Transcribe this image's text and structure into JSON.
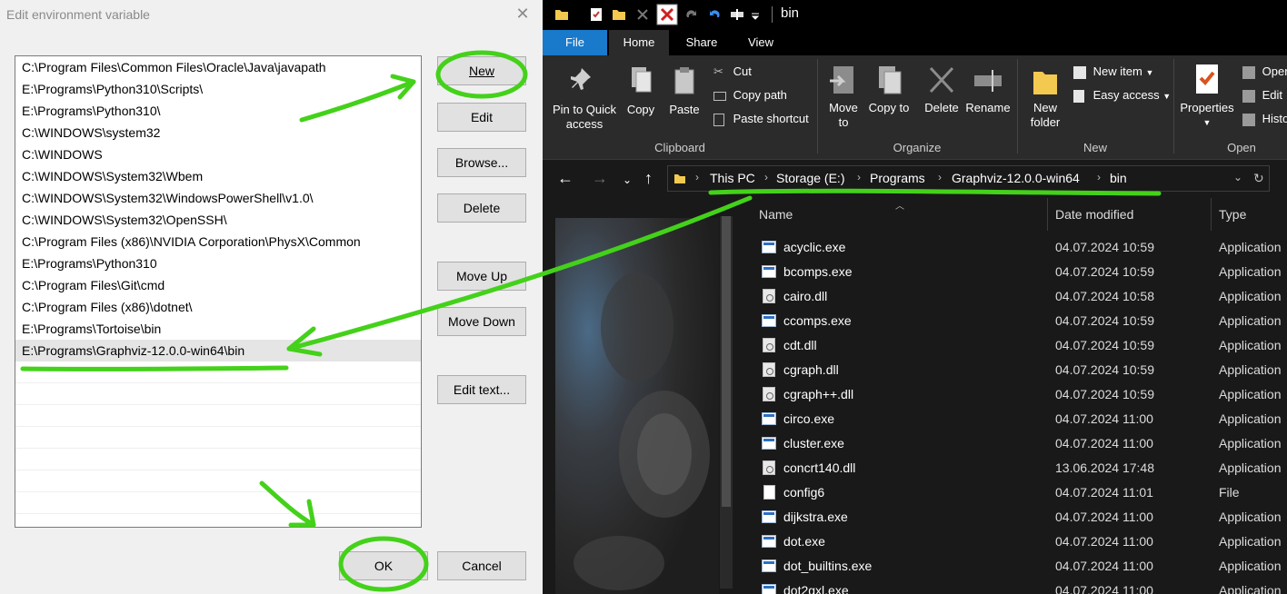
{
  "dialog": {
    "title": "Edit environment variable",
    "paths": [
      "C:\\Program Files\\Common Files\\Oracle\\Java\\javapath",
      "E:\\Programs\\Python310\\Scripts\\",
      "E:\\Programs\\Python310\\",
      "C:\\WINDOWS\\system32",
      "C:\\WINDOWS",
      "C:\\WINDOWS\\System32\\Wbem",
      "C:\\WINDOWS\\System32\\WindowsPowerShell\\v1.0\\",
      "C:\\WINDOWS\\System32\\OpenSSH\\",
      "C:\\Program Files (x86)\\NVIDIA Corporation\\PhysX\\Common",
      "E:\\Programs\\Python310",
      "C:\\Program Files\\Git\\cmd",
      "C:\\Program Files (x86)\\dotnet\\",
      "E:\\Programs\\Tortoise\\bin",
      "E:\\Programs\\Graphviz-12.0.0-win64\\bin"
    ],
    "selected_path": "E:\\Programs\\Graphviz-12.0.0-win64\\bin",
    "buttons": {
      "new": "New",
      "edit": "Edit",
      "browse": "Browse...",
      "delete": "Delete",
      "move_up": "Move Up",
      "move_down": "Move Down",
      "edit_text": "Edit text...",
      "ok": "OK",
      "cancel": "Cancel"
    }
  },
  "explorer": {
    "window_title": "bin",
    "tabs": [
      "File",
      "Home",
      "Share",
      "View"
    ],
    "ribbon": {
      "pin_to_quick_access": "Pin to Quick access",
      "copy": "Copy",
      "paste": "Paste",
      "cut": "Cut",
      "copy_path": "Copy path",
      "paste_shortcut": "Paste shortcut",
      "move_to": "Move to",
      "copy_to": "Copy to",
      "delete": "Delete",
      "rename": "Rename",
      "new_folder": "New folder",
      "new_item": "New item",
      "easy_access": "Easy access",
      "properties": "Properties",
      "open": "Open",
      "edit": "Edit",
      "history": "History",
      "groups": [
        "Clipboard",
        "Organize",
        "New",
        "Open"
      ]
    },
    "breadcrumb": [
      "This PC",
      "Storage (E:)",
      "Programs",
      "Graphviz-12.0.0-win64",
      "bin"
    ],
    "columns": {
      "name": "Name",
      "date": "Date modified",
      "type": "Type"
    },
    "files": [
      {
        "name": "acyclic.exe",
        "date": "04.07.2024 10:59",
        "type": "Application",
        "icon": "exe-icon"
      },
      {
        "name": "bcomps.exe",
        "date": "04.07.2024 10:59",
        "type": "Application",
        "icon": "exe-icon"
      },
      {
        "name": "cairo.dll",
        "date": "04.07.2024 10:58",
        "type": "Application",
        "icon": "dll-icon"
      },
      {
        "name": "ccomps.exe",
        "date": "04.07.2024 10:59",
        "type": "Application",
        "icon": "exe-icon"
      },
      {
        "name": "cdt.dll",
        "date": "04.07.2024 10:59",
        "type": "Application",
        "icon": "dll-icon"
      },
      {
        "name": "cgraph.dll",
        "date": "04.07.2024 10:59",
        "type": "Application",
        "icon": "dll-icon"
      },
      {
        "name": "cgraph++.dll",
        "date": "04.07.2024 10:59",
        "type": "Application",
        "icon": "dll-icon"
      },
      {
        "name": "circo.exe",
        "date": "04.07.2024 11:00",
        "type": "Application",
        "icon": "exe-icon"
      },
      {
        "name": "cluster.exe",
        "date": "04.07.2024 11:00",
        "type": "Application",
        "icon": "exe-icon"
      },
      {
        "name": "concrt140.dll",
        "date": "13.06.2024 17:48",
        "type": "Application",
        "icon": "dll-icon"
      },
      {
        "name": "config6",
        "date": "04.07.2024 11:01",
        "type": "File",
        "icon": "file-icon"
      },
      {
        "name": "dijkstra.exe",
        "date": "04.07.2024 11:00",
        "type": "Application",
        "icon": "exe-icon"
      },
      {
        "name": "dot.exe",
        "date": "04.07.2024 11:00",
        "type": "Application",
        "icon": "exe-icon"
      },
      {
        "name": "dot_builtins.exe",
        "date": "04.07.2024 11:00",
        "type": "Application",
        "icon": "exe-icon"
      },
      {
        "name": "dot2gxl.exe",
        "date": "04.07.2024 11:00",
        "type": "Application",
        "icon": "exe-icon"
      }
    ]
  },
  "colors": {
    "annotation_green": "#44d11a",
    "file_tab_blue": "#1979ca",
    "explorer_bg": "#191919"
  }
}
